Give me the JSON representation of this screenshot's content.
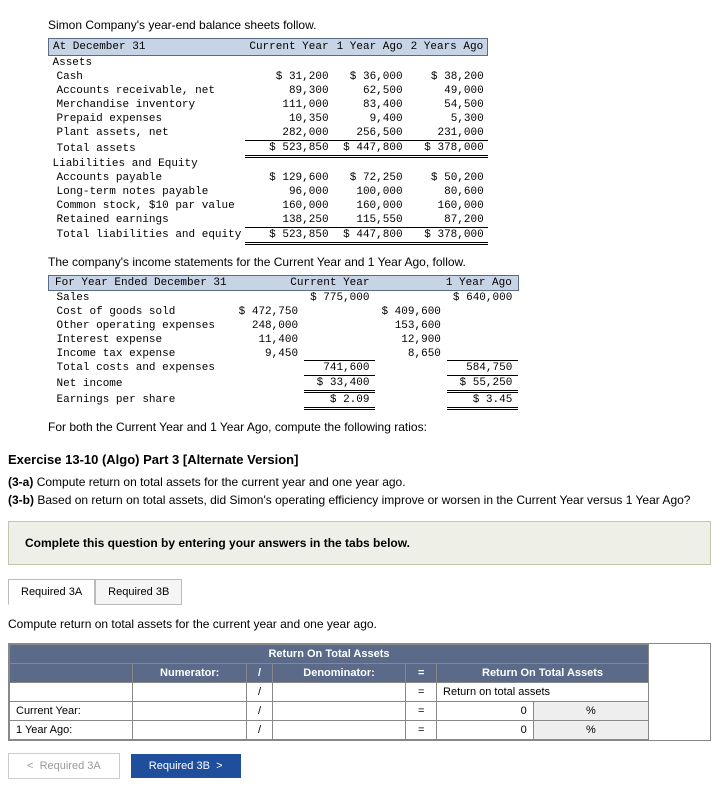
{
  "narr1": "Simon Company's year-end balance sheets follow.",
  "bs": {
    "cols": [
      "At December 31",
      "Current Year",
      "1 Year Ago",
      "2 Years Ago"
    ],
    "assets_h": "Assets",
    "rows_a": [
      {
        "l": "Cash",
        "a": "$ 31,200",
        "b": "$ 36,000",
        "c": "$ 38,200"
      },
      {
        "l": "Accounts receivable, net",
        "a": "89,300",
        "b": "62,500",
        "c": "49,000"
      },
      {
        "l": "Merchandise inventory",
        "a": "111,000",
        "b": "83,400",
        "c": "54,500"
      },
      {
        "l": "Prepaid expenses",
        "a": "10,350",
        "b": "9,400",
        "c": "5,300"
      },
      {
        "l": "Plant assets, net",
        "a": "282,000",
        "b": "256,500",
        "c": "231,000"
      }
    ],
    "tot_a": {
      "l": "Total assets",
      "a": "$ 523,850",
      "b": "$ 447,800",
      "c": "$ 378,000"
    },
    "le_h": "Liabilities and Equity",
    "rows_l": [
      {
        "l": "Accounts payable",
        "a": "$ 129,600",
        "b": "$ 72,250",
        "c": "$ 50,200"
      },
      {
        "l": "Long-term notes payable",
        "a": "96,000",
        "b": "100,000",
        "c": "80,600"
      },
      {
        "l": "Common stock, $10 par value",
        "a": "160,000",
        "b": "160,000",
        "c": "160,000"
      },
      {
        "l": "Retained earnings",
        "a": "138,250",
        "b": "115,550",
        "c": "87,200"
      }
    ],
    "tot_l": {
      "l": "Total liabilities and equity",
      "a": "$ 523,850",
      "b": "$ 447,800",
      "c": "$ 378,000"
    }
  },
  "narr2": "The company's income statements for the Current Year and 1 Year Ago, follow.",
  "is": {
    "cols": [
      "For Year Ended December 31",
      "Current Year",
      "1 Year Ago"
    ],
    "sales": {
      "l": "Sales",
      "a": "$ 775,000",
      "b": "$ 640,000"
    },
    "exp": [
      {
        "l": "Cost of goods sold",
        "a": "$ 472,750",
        "b": "$ 409,600"
      },
      {
        "l": "Other operating expenses",
        "a": "248,000",
        "b": "153,600"
      },
      {
        "l": "Interest expense",
        "a": "11,400",
        "b": "12,900"
      },
      {
        "l": "Income tax expense",
        "a": "9,450",
        "b": "8,650"
      }
    ],
    "tce": {
      "l": "Total costs and expenses",
      "a": "741,600",
      "b": "584,750"
    },
    "ni": {
      "l": "Net income",
      "a": "$ 33,400",
      "b": "$ 55,250"
    },
    "eps": {
      "l": "Earnings per share",
      "a": "$ 2.09",
      "b": "$ 3.45"
    }
  },
  "narr3": "For both the Current Year and 1 Year Ago, compute the following ratios:",
  "ex_title": "Exercise 13-10 (Algo) Part 3 [Alternate Version]",
  "q3a": "(3-a)",
  "q3a_t": "Compute return on total assets for the current year and one year ago.",
  "q3b": "(3-b)",
  "q3b_t": "Based on return on total assets, did Simon's operating efficiency improve or worsen in the Current Year versus 1 Year Ago?",
  "complete": "Complete this question by entering your answers in the tabs below.",
  "tabs": {
    "a": "Required 3A",
    "b": "Required 3B"
  },
  "tab_instr": "Compute return on total assets for the current year and one year ago.",
  "roa": {
    "title": "Return On Total Assets",
    "numerator": "Numerator:",
    "sep": "/",
    "denominator": "Denominator:",
    "eq": "=",
    "res_h": "Return On Total Assets",
    "res_sub": "Return on total assets",
    "rows": [
      {
        "l": "Current Year:",
        "v": "0",
        "p": "%"
      },
      {
        "l": "1 Year Ago:",
        "v": "0",
        "p": "%"
      }
    ]
  },
  "nav": {
    "prev": "Required 3A",
    "next": "Required 3B"
  },
  "chev_l": "<",
  "chev_r": ">"
}
